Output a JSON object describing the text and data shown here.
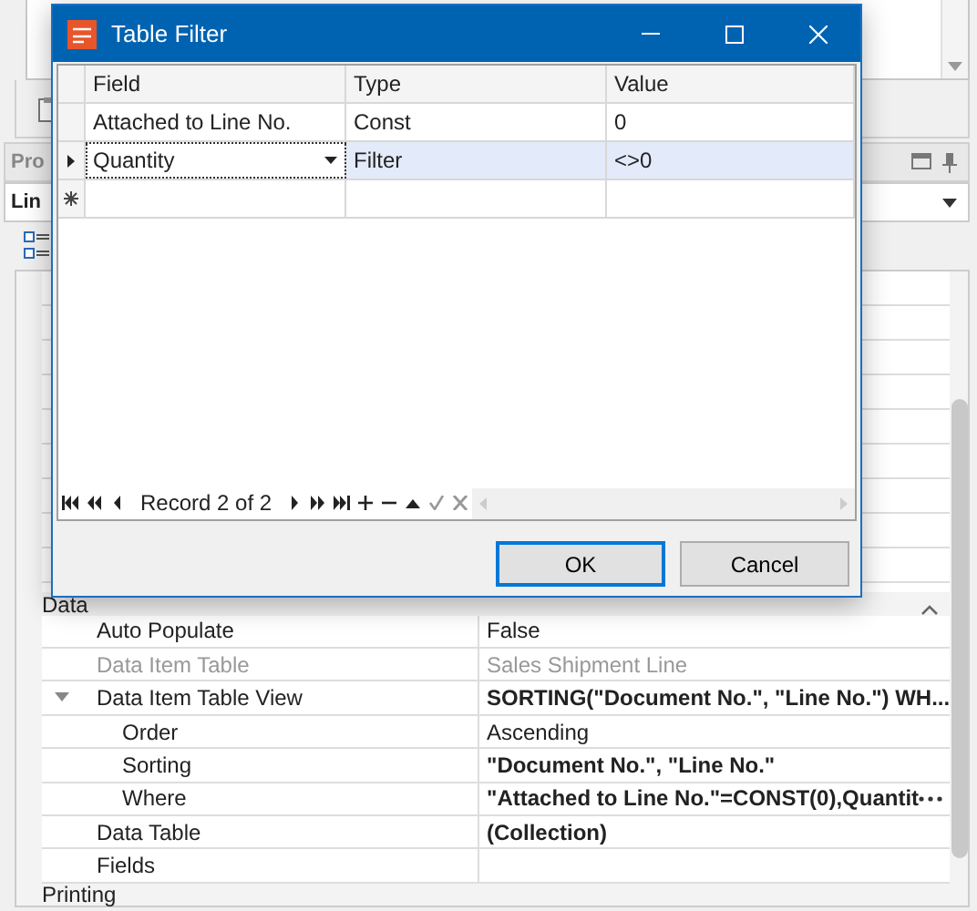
{
  "background": {
    "panel_title": "Pro",
    "object_selector": "Lin",
    "section": "Data",
    "properties": [
      {
        "name": "Auto Populate",
        "value": "False",
        "bold": false,
        "disabled": false
      },
      {
        "name": "Data Item Table",
        "value": "Sales Shipment Line",
        "bold": false,
        "disabled": true
      },
      {
        "name": "Data Item Table View",
        "value": "SORTING(\"Document No.\", \"Line No.\") WH...",
        "bold": true,
        "disabled": false,
        "expanded": true,
        "children": [
          {
            "name": "Order",
            "value": "Ascending",
            "bold": false,
            "disabled": false
          },
          {
            "name": "Sorting",
            "value": "\"Document No.\", \"Line No.\"",
            "bold": true,
            "disabled": false
          },
          {
            "name": "Where",
            "value": "\"Attached to Line No.\"=CONST(0),Quantit",
            "bold": true,
            "disabled": false,
            "edit_button": true
          }
        ]
      },
      {
        "name": "Data Table",
        "value": "(Collection)",
        "bold": true,
        "disabled": false
      },
      {
        "name": "Fields",
        "bold": false,
        "disabled": false
      }
    ],
    "next_section": "Printing"
  },
  "dialog": {
    "title": "Table Filter",
    "columns": [
      "Field",
      "Type",
      "Value"
    ],
    "rows": [
      {
        "field": "Attached to Line No.",
        "type": "Const",
        "value": "0",
        "selected": false
      },
      {
        "field": "Quantity",
        "type": "Filter",
        "value": "<>0",
        "selected": true
      }
    ],
    "navigator": "Record 2 of 2",
    "buttons": [
      {
        "label": "OK",
        "default": true
      },
      {
        "label": "Cancel",
        "default": false
      }
    ]
  }
}
